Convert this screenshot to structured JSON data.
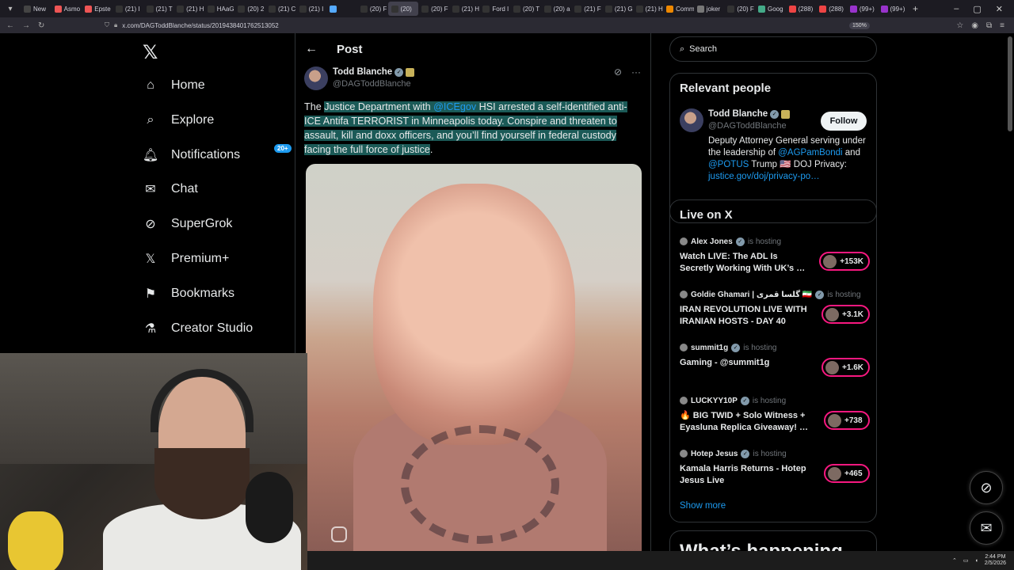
{
  "browser": {
    "tabs": [
      "New",
      "Asmo",
      "Epste",
      "(21) I",
      "(21) T",
      "(21) H",
      "HAaG",
      "(20) 2",
      "(21) C",
      "(21) I",
      "",
      "(20) F",
      "(20)",
      "(20) F",
      "(21) H",
      "Ford I",
      "(20) T",
      "(20) a",
      "(21) F",
      "(21) G",
      "(21) H",
      "Comm",
      "joker",
      "(20) F",
      "Goog",
      "(288)",
      "(288)",
      "(99+)",
      "(99+)"
    ],
    "active_tab_index": 12,
    "url": "x.com/DAGToddBlanche/status/2019438401762513052",
    "zoom": "150%"
  },
  "nav": {
    "items": [
      {
        "label": "Home",
        "icon": "home-icon"
      },
      {
        "label": "Explore",
        "icon": "search-icon"
      },
      {
        "label": "Notifications",
        "icon": "bell-icon"
      },
      {
        "label": "Chat",
        "icon": "mail-icon"
      },
      {
        "label": "SuperGrok",
        "icon": "grok-icon"
      },
      {
        "label": "Premium+",
        "icon": "x-icon"
      },
      {
        "label": "Bookmarks",
        "icon": "bookmark-icon"
      },
      {
        "label": "Creator Studio",
        "icon": "flask-icon"
      }
    ],
    "notification_badge": "20+"
  },
  "post": {
    "header_title": "Post",
    "author_name": "Todd Blanche",
    "author_handle": "@DAGToddBlanche",
    "text_before": "The ",
    "text_hl_1": "Justice Department with ",
    "mention": "@ICEgov",
    "text_hl_2": " HSI arrested a self-identified anti-ICE Antifa TERRORIST in Minneapolis today. Conspire and threaten to assault, kill and doxx officers, and you’ll find yourself in federal custody facing the full force of justice",
    "text_after": "."
  },
  "search": {
    "placeholder": "Search"
  },
  "relevant_people": {
    "title": "Relevant people",
    "name": "Todd Blanche",
    "handle": "@DAGToddBlanche",
    "follow_label": "Follow",
    "bio_1": "Deputy Attorney General serving under the leadership of ",
    "bio_mention_1": "@AGPamBondi",
    "bio_2": " and ",
    "bio_mention_2": "@POTUS",
    "bio_3": " Trump 🇺🇸 DOJ Privacy: ",
    "bio_link": "justice.gov/doj/privacy-po…"
  },
  "live": {
    "title": "Live on X",
    "hosting_label": "is hosting",
    "items": [
      {
        "host": "Alex Jones",
        "title": "Watch LIVE: The ADL Is Secretly Working With UK’s …",
        "count": "+153K"
      },
      {
        "host": "Goldie Ghamari | گلسا قمری 🇮🇷",
        "title": "IRAN REVOLUTION LIVE WITH IRANIAN HOSTS - DAY 40",
        "count": "+3.1K"
      },
      {
        "host": "summit1g",
        "title": "Gaming - @summit1g",
        "count": "+1.6K"
      },
      {
        "host": "LUCKYY10P",
        "title": "🔥 BIG TWID + Solo Witness + Eyasluna Replica Giveaway! …",
        "count": "+738"
      },
      {
        "host": "Hotep Jesus",
        "title": "Kamala Harris Returns - Hotep Jesus Live",
        "count": "+465"
      }
    ],
    "show_more": "Show more"
  },
  "whats_happening": {
    "title": "What’s happening"
  },
  "taskbar": {
    "time": "2:44 PM",
    "date": "2/5/2026"
  }
}
